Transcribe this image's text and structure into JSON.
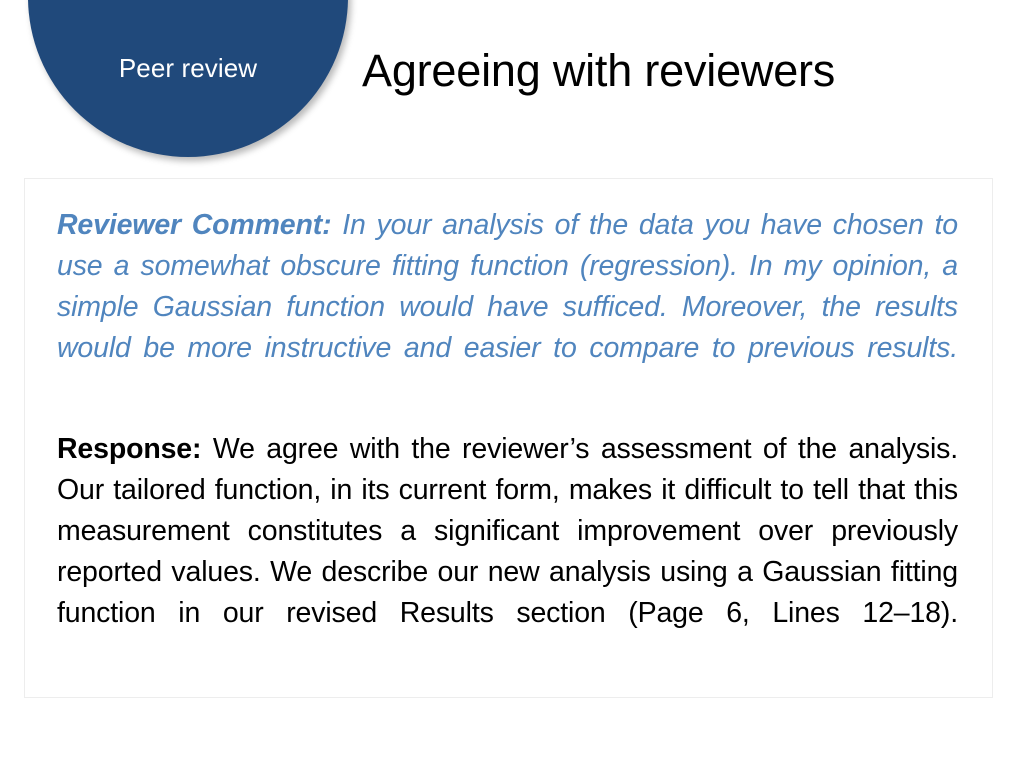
{
  "slide": {
    "background_color": "#ffffff",
    "badge": {
      "label": "Peer review",
      "fill_color": "#20497B",
      "text_color": "#ffffff"
    },
    "title": "Agreeing with reviewers",
    "title_color": "#000000"
  },
  "content": {
    "border_color": "#EDEDED",
    "reviewer_comment": {
      "lead": "Reviewer Comment:",
      "body": " In your analysis of the data you have chosen to use a somewhat obscure fitting function (regression).  In my opinion, a simple Gaussian function would have sufficed. Moreover, the results would be more instructive and easier to compare to previous results.",
      "color": "#5085BE"
    },
    "response": {
      "lead": "Response:",
      "body": " We agree with the reviewer’s assessment of the analysis. Our tailored function, in its current form, makes it difficult to tell that this measurement constitutes a significant improvement over previously reported values. We describe our new analysis using a Gaussian fitting function in our revised Results section (Page 6, Lines 12–18).",
      "color": "#000000"
    }
  }
}
